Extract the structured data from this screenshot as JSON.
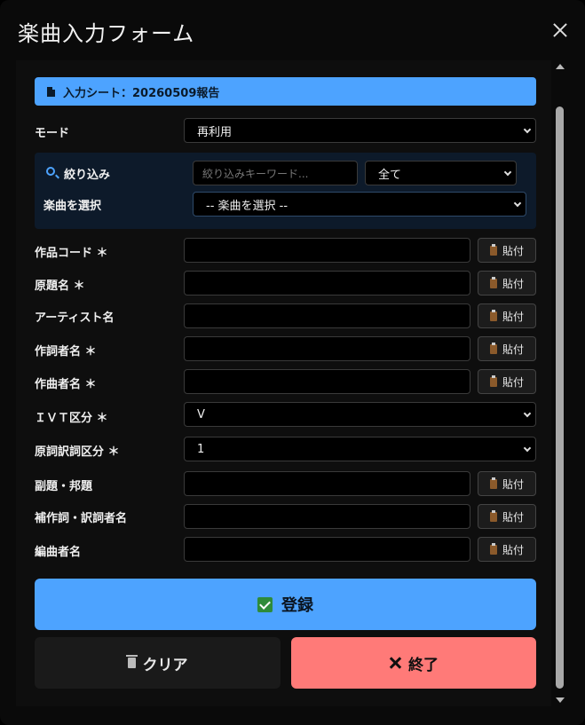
{
  "window": {
    "title": "楽曲入力フォーム"
  },
  "sheet": {
    "label": "入力シート：20260509報告"
  },
  "mode": {
    "label": "モード",
    "value": "再利用"
  },
  "filter": {
    "label": "絞り込み",
    "placeholder": "絞り込みキーワード...",
    "category_value": "全て",
    "song_label": "楽曲を選択",
    "song_value": "-- 楽曲を選択 --"
  },
  "fields": {
    "work_code": "作品コード ＊",
    "original_title": "原題名 ＊",
    "artist": "アーティスト名",
    "lyricist": "作詞者名 ＊",
    "composer": "作曲者名 ＊",
    "ivt_label": "ＩＶＴ区分 ＊",
    "ivt_value": "V",
    "orig_trans_label": "原詞訳詞区分 ＊",
    "orig_trans_value": "1",
    "subtitle": "副題・邦題",
    "supp_lyricist": "補作詞・訳詞者名",
    "arranger": "編曲者名"
  },
  "paste_label": "貼付",
  "buttons": {
    "register": "登録",
    "clear": "クリア",
    "exit": "終了"
  },
  "colors": {
    "accent": "#4da3ff",
    "danger": "#ff7a78",
    "background": "#0a0a0a"
  },
  "icons": [
    "close-icon",
    "document-icon",
    "search-icon",
    "clipboard-icon",
    "check-icon",
    "trash-icon",
    "x-icon"
  ]
}
